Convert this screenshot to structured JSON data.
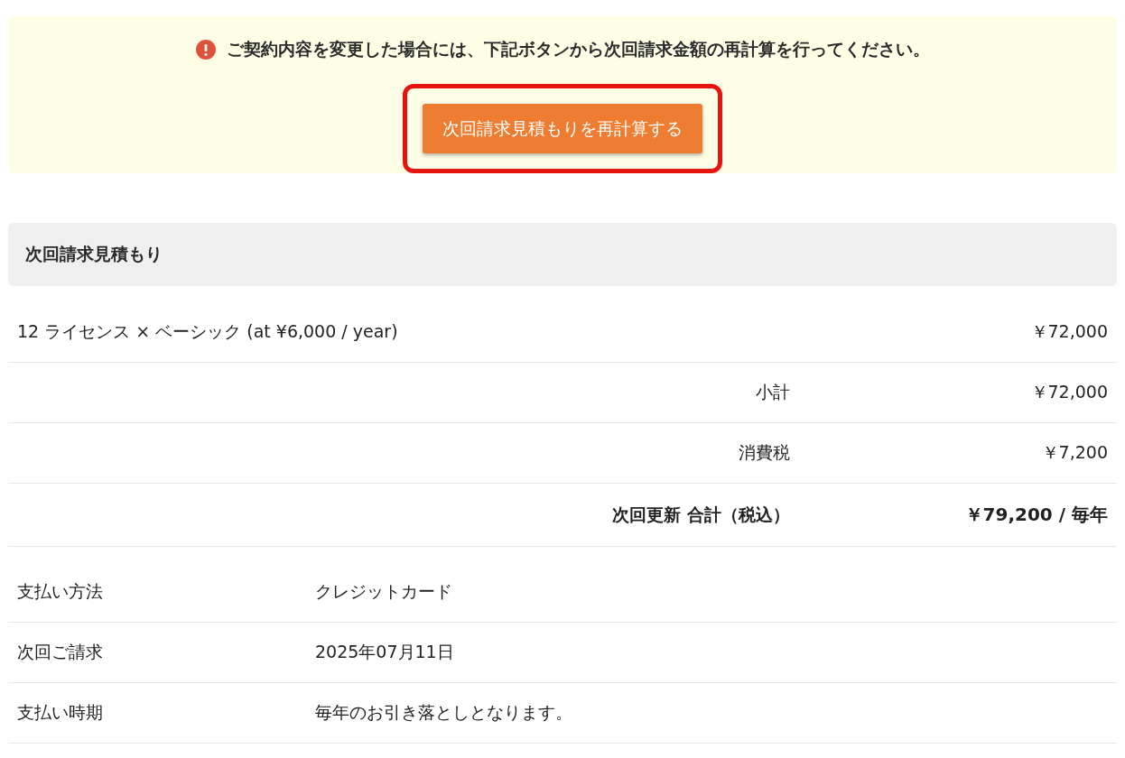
{
  "notice": {
    "message": "ご契約内容を変更した場合には、下記ボタンから次回請求金額の再計算を行ってください。",
    "button": {
      "label": "次回請求見積もりを再計算する",
      "highlighted": true
    }
  },
  "estimate": {
    "title": "次回請求見積もり",
    "lines": [
      {
        "kind": "item",
        "label": "12 ライセンス × ベーシック (at ¥6,000 / year)",
        "amount": "￥72,000"
      },
      {
        "kind": "summary",
        "label": "小計",
        "amount": "￥72,000"
      },
      {
        "kind": "summary",
        "label": "消費税",
        "amount": "￥7,200"
      },
      {
        "kind": "total",
        "label": "次回更新 合計（税込）",
        "amount": "￥79,200 / 毎年"
      }
    ]
  },
  "details": [
    {
      "label": "支払い方法",
      "value": "クレジットカード"
    },
    {
      "label": "次回ご請求",
      "value": "2025年07月11日"
    },
    {
      "label": "支払い時期",
      "value": "毎年のお引き落としとなります。"
    }
  ]
}
